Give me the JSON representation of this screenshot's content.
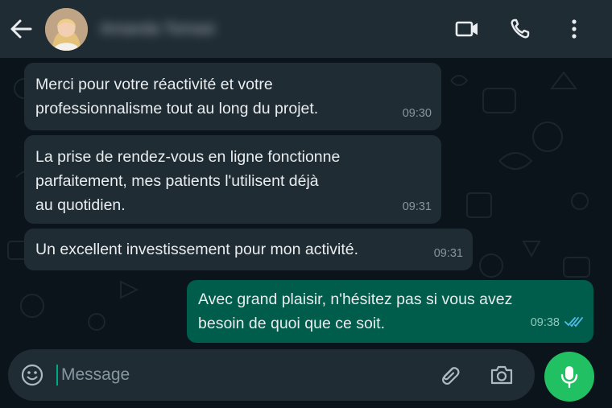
{
  "header": {
    "contact_name": "Amanda Tomasi",
    "icons": [
      "back-arrow-icon",
      "avatar",
      "video-call-icon",
      "voice-call-icon",
      "more-options-icon"
    ]
  },
  "messages": [
    {
      "direction": "incoming",
      "lines": [
        "Merci pour votre réactivité et votre",
        "professionnalisme tout au long du projet."
      ],
      "time": "09:30"
    },
    {
      "direction": "incoming",
      "lines": [
        "La prise de rendez-vous en ligne fonctionne",
        "parfaitement, mes patients l'utilisent déjà",
        "au quotidien."
      ],
      "time": "09:31"
    },
    {
      "direction": "incoming",
      "lines": [
        "Un excellent investissement pour mon activité."
      ],
      "time": "09:31"
    },
    {
      "direction": "outgoing",
      "lines": [
        "Avec grand plaisir, n'hésitez pas si vous avez",
        "besoin de quoi que ce soit."
      ],
      "time": "09:38",
      "status": "read"
    }
  ],
  "composer": {
    "placeholder": "Message",
    "value": ""
  },
  "colors": {
    "background": "#0b141a",
    "header": "#1f2c34",
    "incoming_bubble": "#202c33",
    "outgoing_bubble": "#005c4b",
    "accent": "#21c063",
    "read_ticks": "#53bdeb"
  }
}
